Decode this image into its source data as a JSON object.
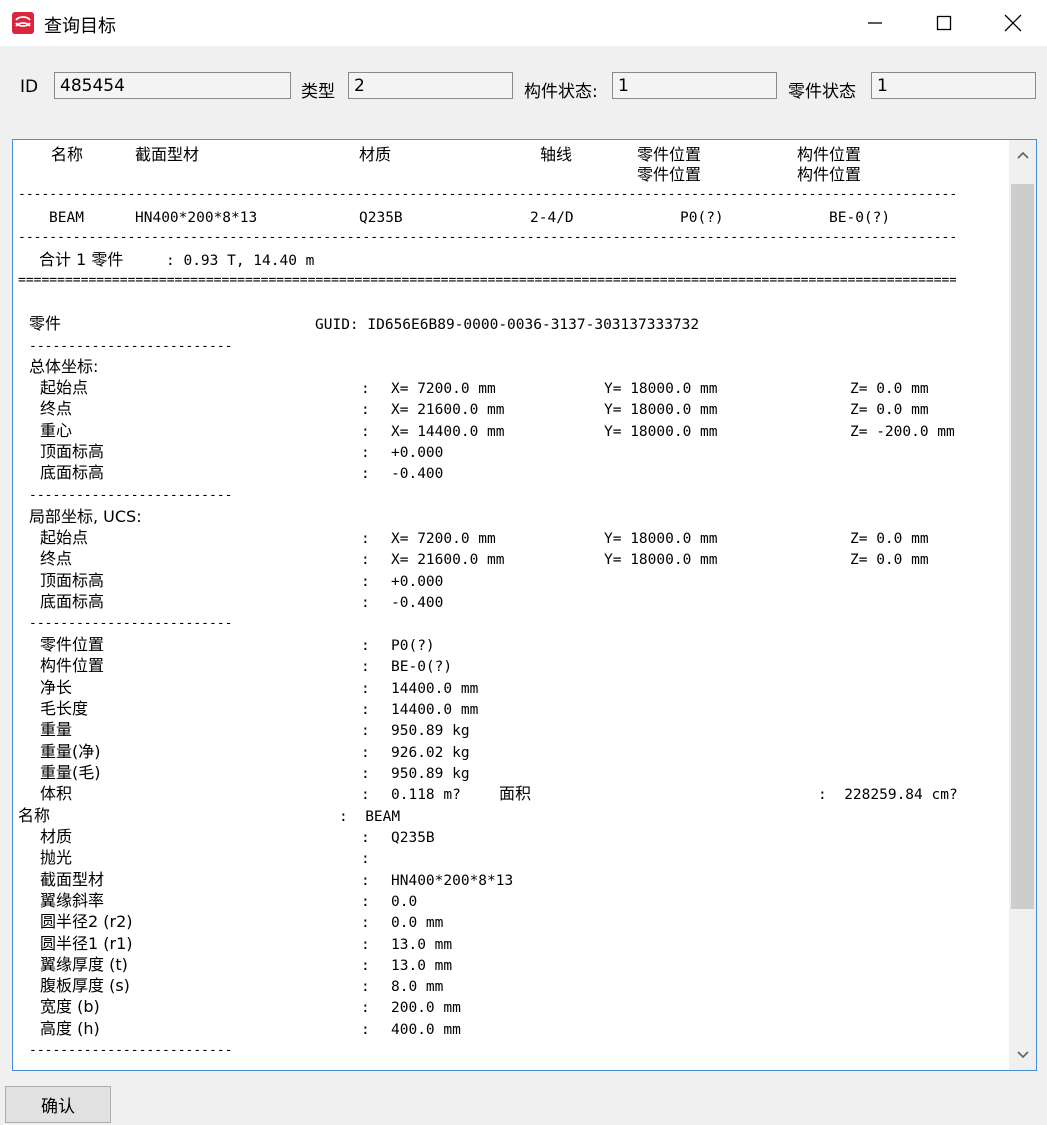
{
  "window": {
    "title": "查询目标",
    "icon": "app-logo-icon",
    "controls": [
      "minimize-icon",
      "maximize-icon",
      "close-icon"
    ]
  },
  "header": {
    "id_label": "ID",
    "id_value": "485454",
    "type_label": "类型",
    "type_value": "2",
    "assembly_status_label": "构件状态:",
    "assembly_status_value": "1",
    "part_status_label": "零件状态",
    "part_status_value": "1"
  },
  "report": {
    "columns": {
      "name": "名称",
      "profile": "截面型材",
      "material": "材质",
      "axis": "轴线",
      "part_pos_1": "零件位置",
      "part_pos_2": "零件位置",
      "assembly_pos_1": "构件位置",
      "assembly_pos_2": "构件位置"
    },
    "row": {
      "name": "BEAM",
      "profile": "HN400*200*8*13",
      "material": "Q235B",
      "axis": "2-4/D",
      "part_pos": "P0(?)",
      "assembly_pos": "BE-0(?)"
    },
    "total_label": "合计 1 零件",
    "total_value": ": 0.93 T, 14.40 m",
    "part_label": "零件",
    "guid": "GUID: ID656E6B89-0000-0036-3137-303137333732",
    "global_title": "总体坐标:",
    "global": [
      {
        "label": "起始点",
        "x": "X= 7200.0 mm",
        "y": "Y= 18000.0 mm",
        "z": "Z= 0.0 mm"
      },
      {
        "label": "终点",
        "x": "X= 21600.0 mm",
        "y": "Y= 18000.0 mm",
        "z": "Z= 0.0 mm"
      },
      {
        "label": "重心",
        "x": "X= 14400.0 mm",
        "y": "Y= 18000.0 mm",
        "z": "Z= -200.0 mm"
      },
      {
        "label": "顶面标高",
        "x": "+0.000",
        "y": "",
        "z": ""
      },
      {
        "label": "底面标高",
        "x": "-0.400",
        "y": "",
        "z": ""
      }
    ],
    "local_title": "局部坐标, UCS:",
    "local": [
      {
        "label": "起始点",
        "x": "X= 7200.0 mm",
        "y": "Y= 18000.0 mm",
        "z": "Z= 0.0 mm"
      },
      {
        "label": "终点",
        "x": "X= 21600.0 mm",
        "y": "Y= 18000.0 mm",
        "z": "Z= 0.0 mm"
      },
      {
        "label": "顶面标高",
        "x": "+0.000",
        "y": "",
        "z": ""
      },
      {
        "label": "底面标高",
        "x": "-0.400",
        "y": "",
        "z": ""
      }
    ],
    "props": [
      {
        "label": "零件位置",
        "value": "P0(?)"
      },
      {
        "label": "构件位置",
        "value": "BE-0(?)"
      },
      {
        "label": "净长",
        "value": "14400.0 mm"
      },
      {
        "label": "毛长度",
        "value": "14400.0 mm"
      },
      {
        "label": "重量",
        "value": "950.89 kg"
      },
      {
        "label": "重量(净)",
        "value": "926.02 kg"
      },
      {
        "label": "重量(毛)",
        "value": "950.89 kg"
      }
    ],
    "volume_label": "体积",
    "volume_value": "0.118 m?",
    "area_label": "面积",
    "area_value": ":  228259.84 cm?",
    "name_label": "名称",
    "name_value": ":  BEAM",
    "section": [
      {
        "label": "材质",
        "value": "Q235B"
      },
      {
        "label": "抛光",
        "value": ""
      },
      {
        "label": "截面型材",
        "value": "HN400*200*8*13"
      },
      {
        "label": "翼缘斜率",
        "value": "0.0"
      },
      {
        "label": "圆半径2 (r2)",
        "value": "0.0 mm"
      },
      {
        "label": "圆半径1 (r1)",
        "value": "13.0 mm"
      },
      {
        "label": "翼缘厚度 (t)",
        "value": "13.0 mm"
      },
      {
        "label": "腹板厚度 (s)",
        "value": "8.0 mm"
      },
      {
        "label": "宽度 (b)",
        "value": "200.0 mm"
      },
      {
        "label": "高度 (h)",
        "value": "400.0 mm"
      }
    ]
  },
  "footer": {
    "ok_label": "确认"
  },
  "colors": {
    "panel_border": "#4a8fd6",
    "scroll_thumb": "#cdcdcd",
    "window_bg": "#f0f0f0"
  }
}
